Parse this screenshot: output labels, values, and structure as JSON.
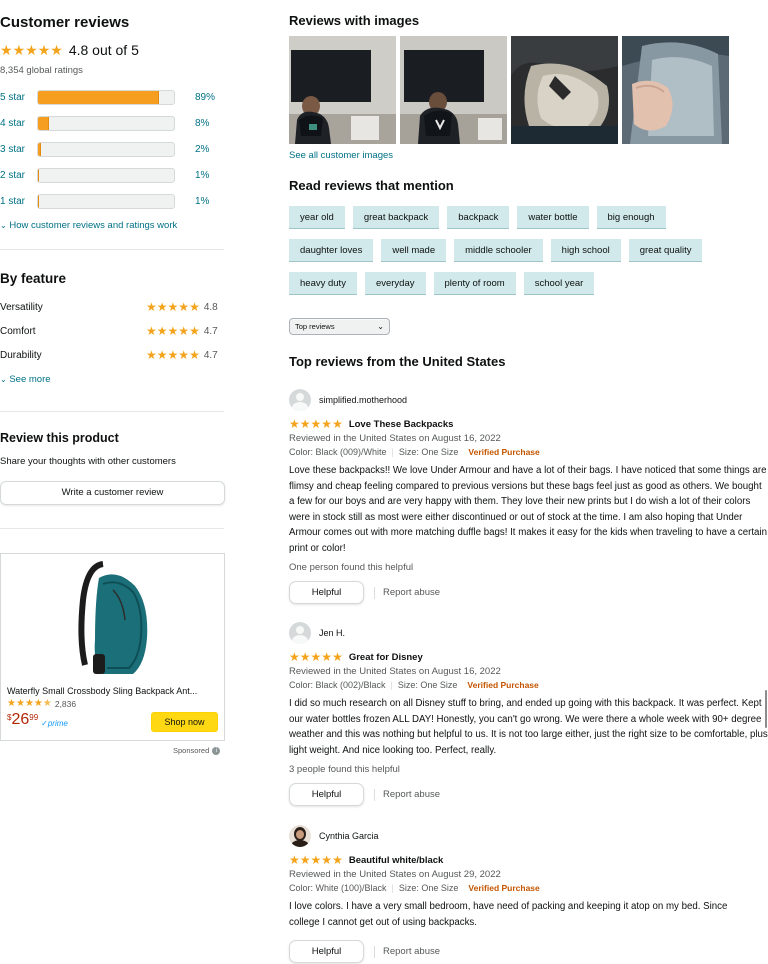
{
  "customer_reviews": {
    "title": "Customer reviews",
    "rating_text": "4.8 out of 5",
    "global_ratings": "8,354 global ratings",
    "histogram": [
      {
        "label": "5 star",
        "percent": 89,
        "pct_text": "89%"
      },
      {
        "label": "4 star",
        "percent": 8,
        "pct_text": "8%"
      },
      {
        "label": "3 star",
        "percent": 2,
        "pct_text": "2%"
      },
      {
        "label": "2 star",
        "percent": 1,
        "pct_text": "1%"
      },
      {
        "label": "1 star",
        "percent": 1,
        "pct_text": "1%"
      }
    ],
    "how_link": "How customer reviews and ratings work"
  },
  "by_feature": {
    "title": "By feature",
    "items": [
      {
        "name": "Versatility",
        "value": "4.8"
      },
      {
        "name": "Comfort",
        "value": "4.7"
      },
      {
        "name": "Durability",
        "value": "4.7"
      }
    ],
    "see_more": "See more"
  },
  "review_product": {
    "title": "Review this product",
    "subtitle": "Share your thoughts with other customers",
    "button": "Write a customer review"
  },
  "ad": {
    "title": "Waterfly Small Crossbody Sling Backpack Ant...",
    "rating_count": "2,836",
    "price_symbol": "$",
    "price_whole": "26",
    "price_fraction": "99",
    "prime": "prime",
    "button": "Shop now",
    "sponsored": "Sponsored"
  },
  "images_section": {
    "title": "Reviews with images",
    "see_all": "See all customer images"
  },
  "mentions": {
    "title": "Read reviews that mention",
    "chips": [
      "year old",
      "great backpack",
      "backpack",
      "water bottle",
      "big enough",
      "daughter loves",
      "well made",
      "middle schooler",
      "high school",
      "great quality",
      "heavy duty",
      "everyday",
      "plenty of room",
      "school year"
    ]
  },
  "sort": {
    "selected": "Top reviews"
  },
  "top_reviews": {
    "title": "Top reviews from the United States",
    "reviews": [
      {
        "author": "simplified.motherhood",
        "title": "Love These Backpacks",
        "meta": "Reviewed in the United States on August 16, 2022",
        "color": "Color: Black (009)/White",
        "size": "Size: One Size",
        "verified": "Verified Purchase",
        "body": "Love these backpacks!! We love Under Armour and have a lot of their bags. I have noticed that some things are flimsy and cheap feeling compared to previous versions but these bags feel just as good as others. We bought a few for our boys and are very happy with them. They love their new prints but I do wish a lot of their colors were in stock still as most were either discontinued or out of stock at the time. I am also hoping that Under Armour comes out with more matching duffle bags! It makes it easy for the kids when traveling to have a certain print or color!",
        "found": "One person found this helpful",
        "helpful": "Helpful",
        "report": "Report abuse"
      },
      {
        "author": "Jen H.",
        "title": "Great for Disney",
        "meta": "Reviewed in the United States on August 16, 2022",
        "color": "Color: Black (002)/Black",
        "size": "Size: One Size",
        "verified": "Verified Purchase",
        "body": "I did so much research on all Disney stuff to bring, and ended up going with this backpack. It was perfect. Kept our water bottles frozen ALL DAY! Honestly, you can't go wrong. We were there a whole week with 90+ degree weather and this was nothing but helpful to us. It is not too large either, just the right size to be comfortable, plus light weight. And nice looking too. Perfect, really.",
        "found": "3 people found this helpful",
        "helpful": "Helpful",
        "report": "Report abuse"
      },
      {
        "author": "Cynthia Garcia",
        "title": "Beautiful white/black",
        "meta": "Reviewed in the United States on August 29, 2022",
        "color": "Color: White (100)/Black",
        "size": "Size: One Size",
        "verified": "Verified Purchase",
        "body": "I love colors. I have a very small bedroom, have need of packing and keeping it atop on my bed. Since college I cannot get out of using backpacks.",
        "helpful": "Helpful",
        "report": "Report abuse"
      }
    ]
  },
  "colors": {
    "star": "#f4a41c",
    "bar_fill": "#f59e20",
    "link": "#007185",
    "verified": "#c45500",
    "chip_bg": "#d1e9ea",
    "shop_btn": "#ffd814"
  }
}
